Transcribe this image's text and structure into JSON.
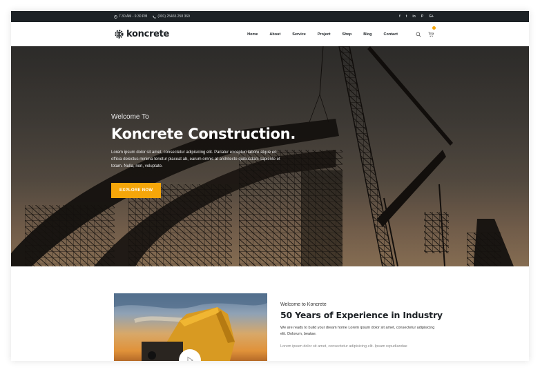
{
  "topbar": {
    "hours": "7.30 AM - 9.30 PM",
    "phone": "(001) 25465 258 369",
    "social": [
      "f",
      "t",
      "in",
      "P",
      "G+"
    ]
  },
  "nav": {
    "logo_text": "koncrete",
    "menu": [
      "Home",
      "About",
      "Service",
      "Project",
      "Shop",
      "Blog",
      "Contact"
    ]
  },
  "hero": {
    "welcome": "Welcome To",
    "title": "Koncrete Construction.",
    "text": "Lorem ipsum dolor sit amet, consectetur adipisicing elit. Pariatur excepturi labore atque eo officia delectus minima tenetur placeat ab, earum omnis at architecto quibusdam sapiente et totam. Nulla, non, voluptate.",
    "button": "EXPLORE NOW"
  },
  "about": {
    "kicker": "Welcome to Koncrete",
    "title": "50 Years of Experience in Industry",
    "desc": "We are ready to build your dream home Lorem ipsum dolor sit amet, consectetur adipisicing elit. Dolorum, beatae.",
    "desc2": "Lorem ipsum dolor sit amet, consectetur adipisicing elit. Ipsam repudiandae"
  },
  "colors": {
    "accent": "#f5a60a",
    "dark": "#1d2226"
  }
}
